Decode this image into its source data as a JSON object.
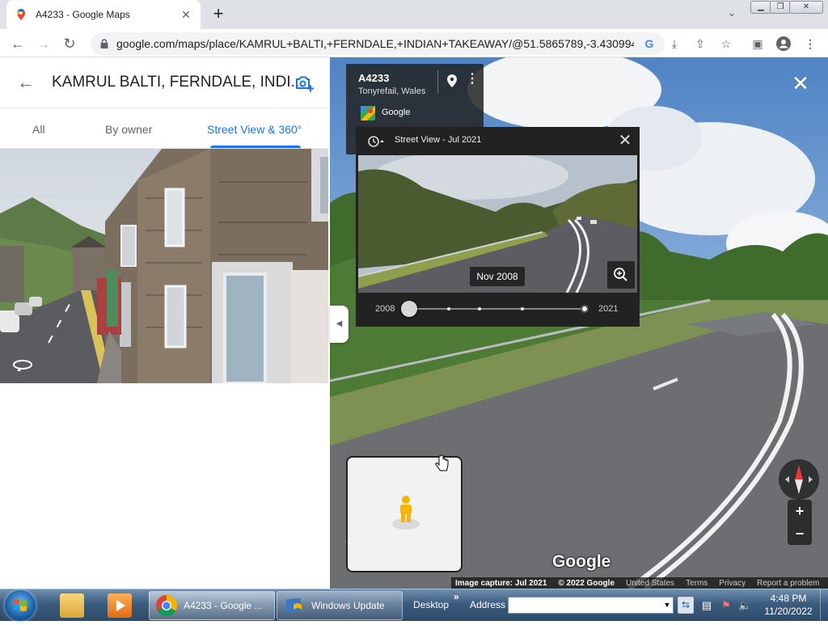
{
  "browser": {
    "tab_title": "A4233 - Google Maps",
    "new_tab_glyph": "+",
    "tab_close_glyph": "✕",
    "url": "google.com/maps/place/KAMRUL+BALTI,+FERNDALE,+INDIAN+TAKEAWAY/@51.5865789,-3.4309941...",
    "window_buttons": [
      "minimize",
      "restore",
      "close"
    ]
  },
  "place_panel": {
    "title": "KAMRUL BALTI, FERNDALE, INDI...",
    "tabs": [
      {
        "label": "All",
        "active": false
      },
      {
        "label": "By owner",
        "active": false
      },
      {
        "label": "Street View & 360°",
        "active": true
      }
    ],
    "collapse_glyph": "◀"
  },
  "streetview": {
    "road": "A4233",
    "location": "Tonyrefail, Wales",
    "provider": "Google",
    "logo_text": "Google",
    "close_glyph": "✕",
    "zoom_in": "+",
    "zoom_out": "−"
  },
  "timeline": {
    "header": "Street View - Jul 2021",
    "close_glyph": "✕",
    "selected_date": "Nov 2008",
    "start_year": "2008",
    "end_year": "2021",
    "slider_fraction": 0.0
  },
  "footer": {
    "capture": "Image capture: Jul 2021",
    "copyright": "© 2022 Google",
    "links": [
      "United States",
      "Terms",
      "Privacy",
      "Report a problem"
    ]
  },
  "taskbar": {
    "items": [
      {
        "label": "A4233 - Google ...",
        "active": true
      },
      {
        "label": "Windows Update",
        "active": false
      }
    ],
    "desktop_label": "Desktop",
    "chevron": "»",
    "address_label": "Address",
    "address_value": "",
    "time": "4:48 PM",
    "date": "11/20/2022"
  },
  "colors": {
    "accent": "#1a73e8",
    "panel_dark": "#222222"
  }
}
